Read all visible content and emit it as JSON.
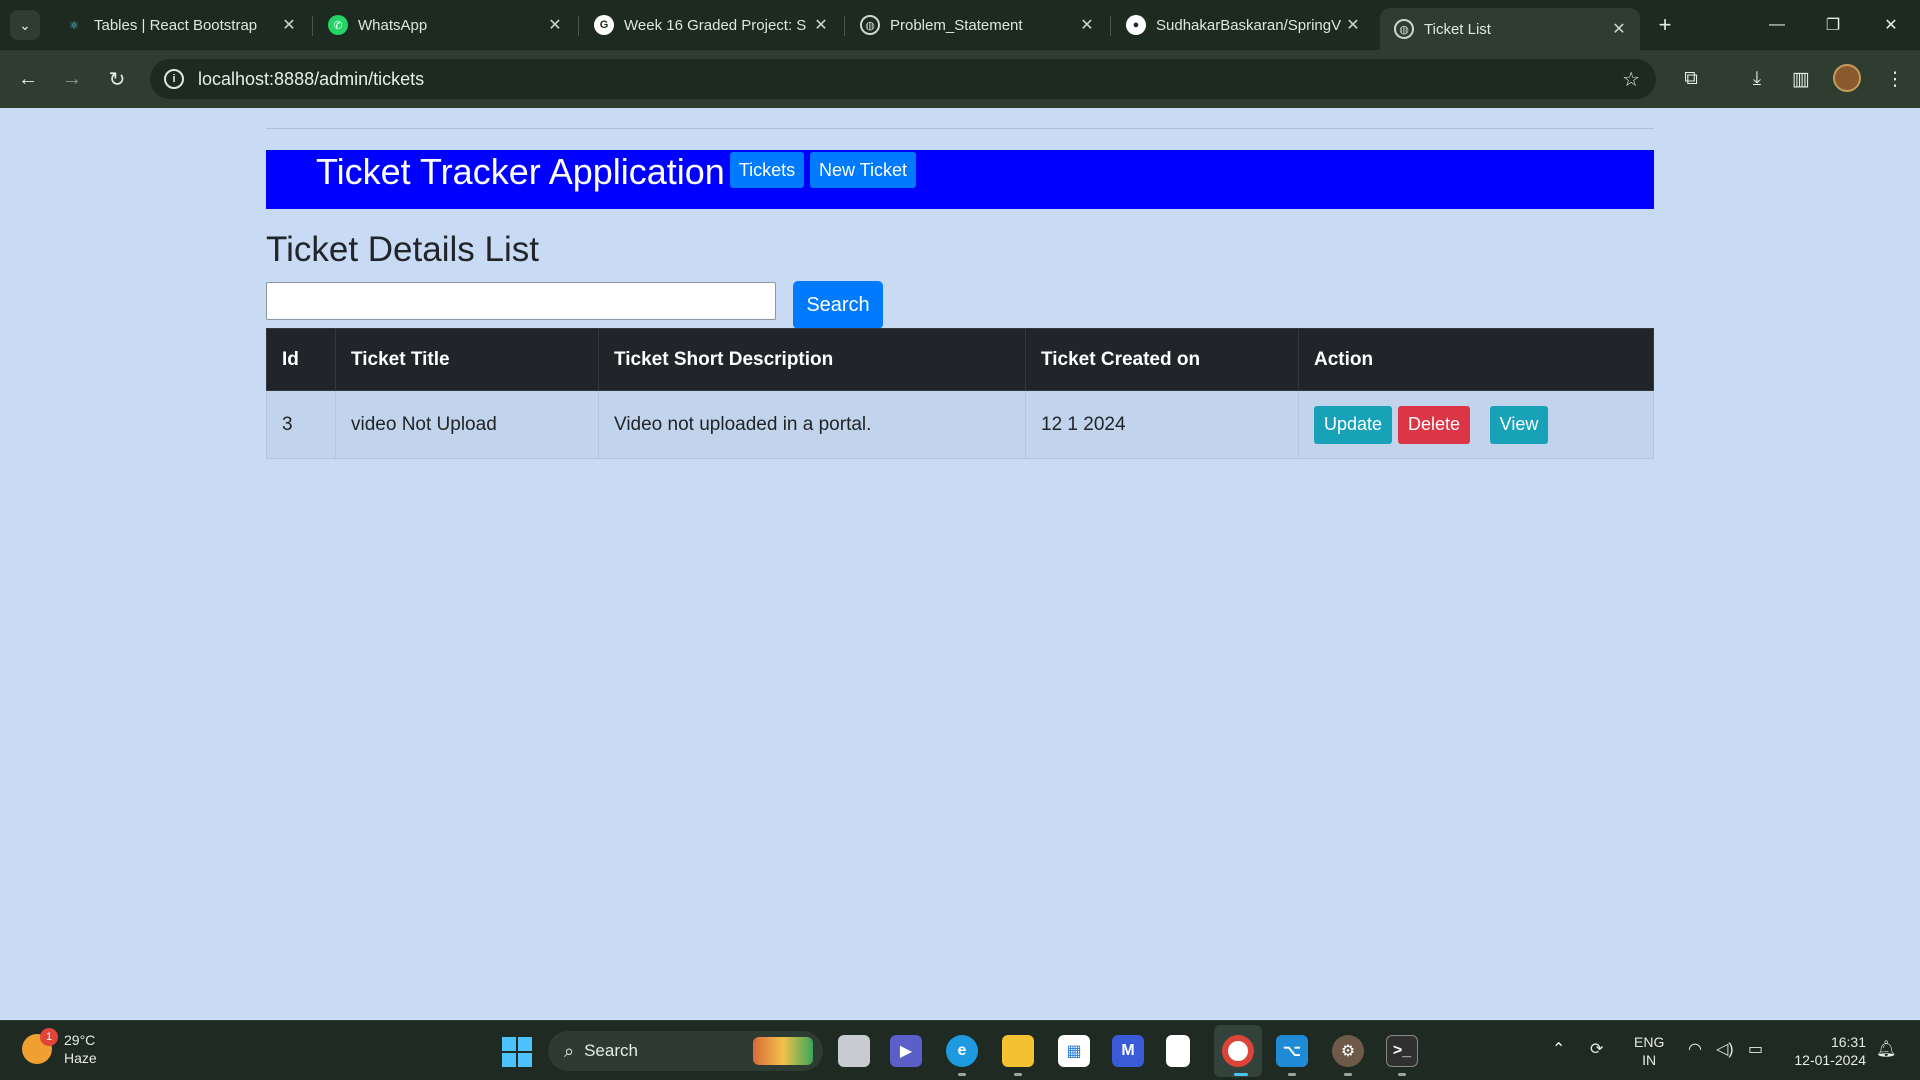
{
  "browser": {
    "tabs": [
      {
        "title": "Tables | React Bootstrap",
        "icon": "react-bootstrap-icon",
        "active": false
      },
      {
        "title": "WhatsApp",
        "icon": "whatsapp-icon",
        "active": false
      },
      {
        "title": "Week 16 Graded Project: S",
        "icon": "google-icon",
        "active": false
      },
      {
        "title": "Problem_Statement",
        "icon": "globe-icon",
        "active": false
      },
      {
        "title": "SudhakarBaskaran/SpringV",
        "icon": "github-icon",
        "active": false
      },
      {
        "title": "Ticket List",
        "icon": "globe-icon",
        "active": true
      }
    ],
    "url": "localhost:8888/admin/tickets"
  },
  "app": {
    "brand": "Ticket Tracker Application",
    "nav": {
      "tickets": "Tickets",
      "new_ticket": "New Ticket"
    },
    "page_title": "Ticket Details List",
    "search": {
      "value": "",
      "button": "Search"
    },
    "table": {
      "headers": [
        "Id",
        "Ticket Title",
        "Ticket Short Description",
        "Ticket Created on",
        "Action"
      ],
      "rows": [
        {
          "id": "3",
          "title": "video Not Upload",
          "description": "Video not uploaded in a portal.",
          "created_on": "12 1 2024",
          "actions": {
            "update": "Update",
            "delete": "Delete",
            "view": "View"
          }
        }
      ]
    },
    "colors": {
      "navbar": "#0000ff",
      "primary": "#007bff",
      "info": "#17a2b8",
      "danger": "#dc3545",
      "page_bg": "#c9dbf4",
      "table_header": "#212529"
    }
  },
  "taskbar": {
    "weather": {
      "temp": "29°C",
      "condition": "Haze",
      "badge": "1"
    },
    "search_label": "Search",
    "language": {
      "line1": "ENG",
      "line2": "IN"
    },
    "clock": {
      "time": "16:31",
      "date": "12-01-2024"
    }
  }
}
